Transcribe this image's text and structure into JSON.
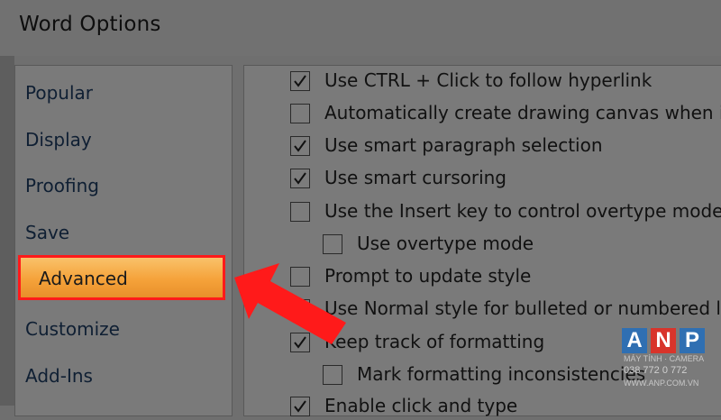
{
  "window": {
    "title": "Word Options"
  },
  "sidebar": {
    "items": [
      {
        "label": "Popular"
      },
      {
        "label": "Display"
      },
      {
        "label": "Proofing"
      },
      {
        "label": "Save"
      },
      {
        "label": "Advanced",
        "selected": true
      },
      {
        "label": "Customize"
      },
      {
        "label": "Add-Ins"
      }
    ]
  },
  "options": [
    {
      "label": "Use CTRL + Click to follow hyperlink",
      "checked": true
    },
    {
      "label": "Automatically create drawing canvas when in",
      "checked": false
    },
    {
      "label": "Use smart paragraph selection",
      "checked": true
    },
    {
      "label": "Use smart cursoring",
      "checked": true
    },
    {
      "label": "Use the Insert key to control overtype mode",
      "checked": false
    },
    {
      "label": "Use overtype mode",
      "checked": false
    },
    {
      "label": "Prompt to update style",
      "checked": false
    },
    {
      "label": "Use Normal style for bulleted or numbered lis",
      "checked": false
    },
    {
      "label": "Keep track of formatting",
      "checked": true
    },
    {
      "label": "Mark formatting inconsistencies",
      "checked": false
    },
    {
      "label": "Enable click and type",
      "checked": true
    }
  ],
  "watermark": {
    "letters": [
      "A",
      "N",
      "P"
    ],
    "line1": "MÁY TÍNH · CAMERA",
    "phone": "038 772 0 772",
    "url": "WWW.ANP.COM.VN"
  },
  "colors": {
    "highlight_border": "#ff1a1a",
    "selected_fill": "#f5a23a",
    "arrow": "#ff1a1a",
    "logo_blue": "#2f6fb2",
    "logo_red": "#d8342b"
  }
}
